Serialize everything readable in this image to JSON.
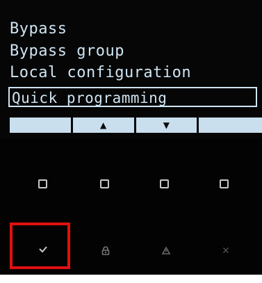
{
  "menu": {
    "items": [
      {
        "label": "Bypass"
      },
      {
        "label": "Bypass group"
      },
      {
        "label": "Local configuration"
      },
      {
        "label": "Quick programming",
        "selected": true
      }
    ]
  },
  "softkeys": [
    {
      "icon": "blank"
    },
    {
      "icon": "arrow-up-icon",
      "glyph": "▲"
    },
    {
      "icon": "arrow-down-icon",
      "glyph": "▼"
    },
    {
      "icon": "blank"
    }
  ],
  "square_keys": [
    "square-key-1",
    "square-key-2",
    "square-key-3",
    "square-key-4"
  ],
  "function_keys": [
    {
      "icon": "check-icon",
      "highlighted": true
    },
    {
      "icon": "lock-icon"
    },
    {
      "icon": "warning-icon"
    },
    {
      "icon": "close-icon"
    }
  ],
  "colors": {
    "lcd_text": "#cfe4f2",
    "softkey_bar": "#c9dfee",
    "background": "#030303",
    "highlight": "#e01010",
    "key_icon": "#c8c8c8"
  }
}
